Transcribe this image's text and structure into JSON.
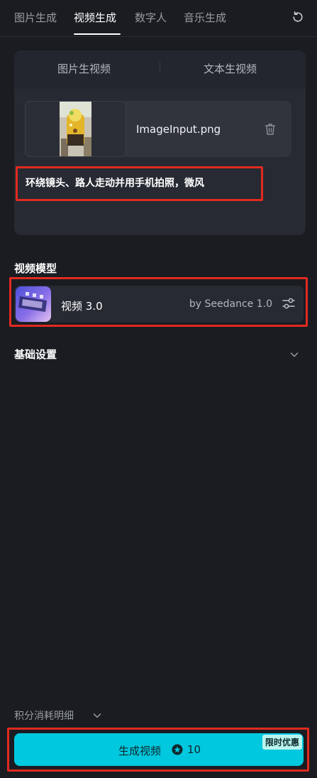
{
  "tabs": [
    "图片生成",
    "视频生成",
    "数字人",
    "音乐生成"
  ],
  "active_tab": "视频生成",
  "mode_tabs": [
    "图片生视频",
    "文本生视频"
  ],
  "file": {
    "name": "ImageInput.png"
  },
  "prompt": "环绕镜头、路人走动并用手机拍照，微风",
  "model_section": {
    "title": "视频模型",
    "name": "视频 3.0",
    "provider": "by Seedance 1.0"
  },
  "basic_settings": "基础设置",
  "credits_detail": "积分消耗明细",
  "generate": {
    "label": "生成视频",
    "cost": "10",
    "promo": "限时优惠"
  },
  "colors": {
    "accent": "#00c8de",
    "highlight": "#e12a1f",
    "background": "#1a1c22"
  }
}
